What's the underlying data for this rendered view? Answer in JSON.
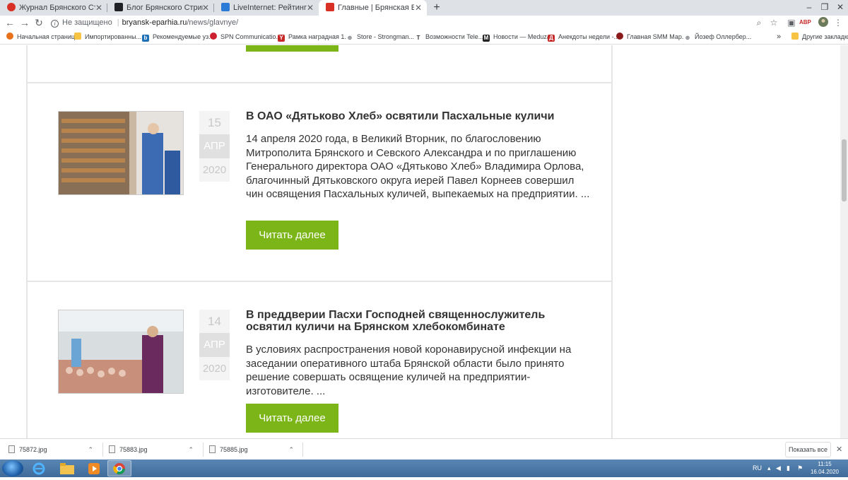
{
  "tabs": [
    {
      "title": "Журнал Брянского Стрингера",
      "favicon_color": "#d93025"
    },
    {
      "title": "Блог Брянского Стрингера | Янд",
      "favicon_color": "#202124"
    },
    {
      "title": "LiveInternet: Рейтинг сайтов",
      "favicon_color": "#2b7bd6"
    },
    {
      "title": "Главные | Брянская Епархия",
      "favicon_color": "#d93025"
    }
  ],
  "new_tab_label": "+",
  "address": {
    "security_label": "Не защищено",
    "url_domain": "bryansk-eparhia.ru",
    "url_path": "/news/glavnye/"
  },
  "bookmarks": [
    {
      "label": "Начальная страница",
      "icon_color": "#e8711a"
    },
    {
      "label": "Импортированны...",
      "icon_color": "#f6c343"
    },
    {
      "label": "Рекомендуемые уз...",
      "icon_color": "#1e6fb8"
    },
    {
      "label": "SPN Communicatio...",
      "icon_color": "#cc1f2f"
    },
    {
      "label": "Рамка наградная 1...",
      "icon_color": "#c62828"
    },
    {
      "label": "Store - Strongman...",
      "icon_color": "#5f6368"
    },
    {
      "label": "Возможности Tele...",
      "icon_color": "#333333"
    },
    {
      "label": "Новости — Meduza",
      "icon_color": "#222222"
    },
    {
      "label": "Анекдоты недели -...",
      "icon_color": "#c62828"
    },
    {
      "label": "Главная SMM Мар...",
      "icon_color": "#8b1a1a"
    },
    {
      "label": "Йозеф Оллербер...",
      "icon_color": "#5f6368"
    }
  ],
  "bookmarks_overflow": "»",
  "other_bookmarks": "Другие закладки",
  "news": [
    {
      "day": "15",
      "month": "АПР",
      "year": "2020",
      "title": "В ОАО «Дятьково Хлеб» освятили Пасхальные куличи",
      "text": "14 апреля 2020 года, в Великий Вторник, по благословению Митрополита Брянского и Севского Александра и по приглашению Генерального директора ОАО «Дятьково Хлеб» Владимира Орлова, благочинный Дятьковского округа иерей Павел Корнеев совершил чин освящения Пасхальных куличей, выпекаемых на предприятии. ...",
      "button": "Читать далее"
    },
    {
      "day": "14",
      "month": "АПР",
      "year": "2020",
      "title": "В преддверии Пасхи Господней священнослужитель освятил куличи на Брянском хлебокомбинате",
      "text": "В условиях распространения новой коронавирусной инфекции на заседании оперативного штаба Брянской области было принято решение совершать освящение куличей на предприятии-изготовителе.  ...",
      "button": "Читать далее"
    }
  ],
  "downloads": [
    {
      "filename": "75872.jpg"
    },
    {
      "filename": "75883.jpg"
    },
    {
      "filename": "75885.jpg"
    }
  ],
  "show_all_label": "Показать все",
  "taskbar": {
    "language": "RU",
    "time": "11:15",
    "date": "16.04.2020"
  },
  "colors": {
    "accent_green": "#7cb518",
    "tab_strip": "#dee1e6",
    "taskbar": "#3e6b99"
  }
}
